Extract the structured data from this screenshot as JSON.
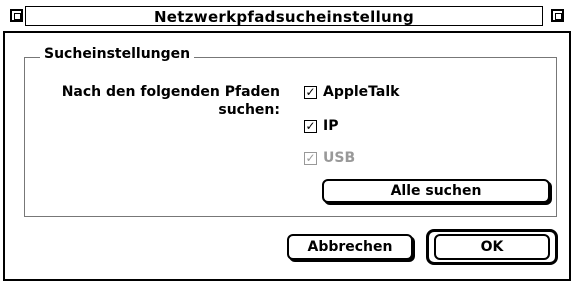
{
  "window": {
    "title": "Netzwerkpfadsucheinstellung"
  },
  "group": {
    "title": "Sucheinstellungen",
    "label": "Nach den folgenden Pfaden suchen:"
  },
  "options": [
    {
      "label": "AppleTalk",
      "checked": true,
      "enabled": true
    },
    {
      "label": "IP",
      "checked": true,
      "enabled": true
    },
    {
      "label": "USB",
      "checked": true,
      "enabled": false
    }
  ],
  "buttons": {
    "search_all": "Alle suchen",
    "cancel": "Abbrechen",
    "ok": "OK"
  },
  "icons": {
    "close": "close-box-icon",
    "zoom": "zoom-box-icon",
    "check": "checkmark-icon"
  }
}
